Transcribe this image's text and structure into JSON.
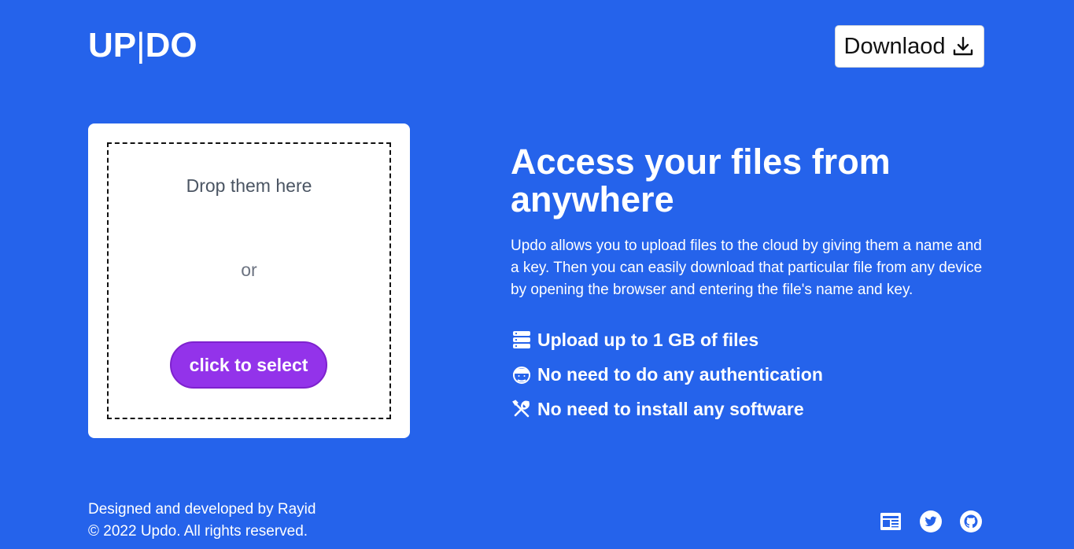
{
  "brand": {
    "logo_left": "UP",
    "logo_sep": "|",
    "logo_right": "DO"
  },
  "header": {
    "download_label": "Downlaod",
    "download_icon": "download-icon"
  },
  "upload": {
    "drop_text": "Drop them here",
    "or_text": "or",
    "select_label": "click to select"
  },
  "hero": {
    "title": "Access your files from anywhere",
    "description": "Updo allows you to upload files to the cloud by giving them a name and a key. Then you can easily download that particular file from any device by opening the browser and entering the file's name and key."
  },
  "features": [
    {
      "icon": "server-icon",
      "text": "Upload up to 1 GB of files"
    },
    {
      "icon": "user-icon",
      "text": "No need to do any authentication"
    },
    {
      "icon": "tools-icon",
      "text": "No need to install any software"
    }
  ],
  "footer": {
    "credit": "Designed and developed by Rayid",
    "copyright": "© 2022 Updo. All rights reserved.",
    "social": [
      "newspaper-icon",
      "twitter-icon",
      "github-icon"
    ]
  },
  "colors": {
    "background": "#2563eb",
    "accent": "#9333ea",
    "card": "#ffffff"
  }
}
